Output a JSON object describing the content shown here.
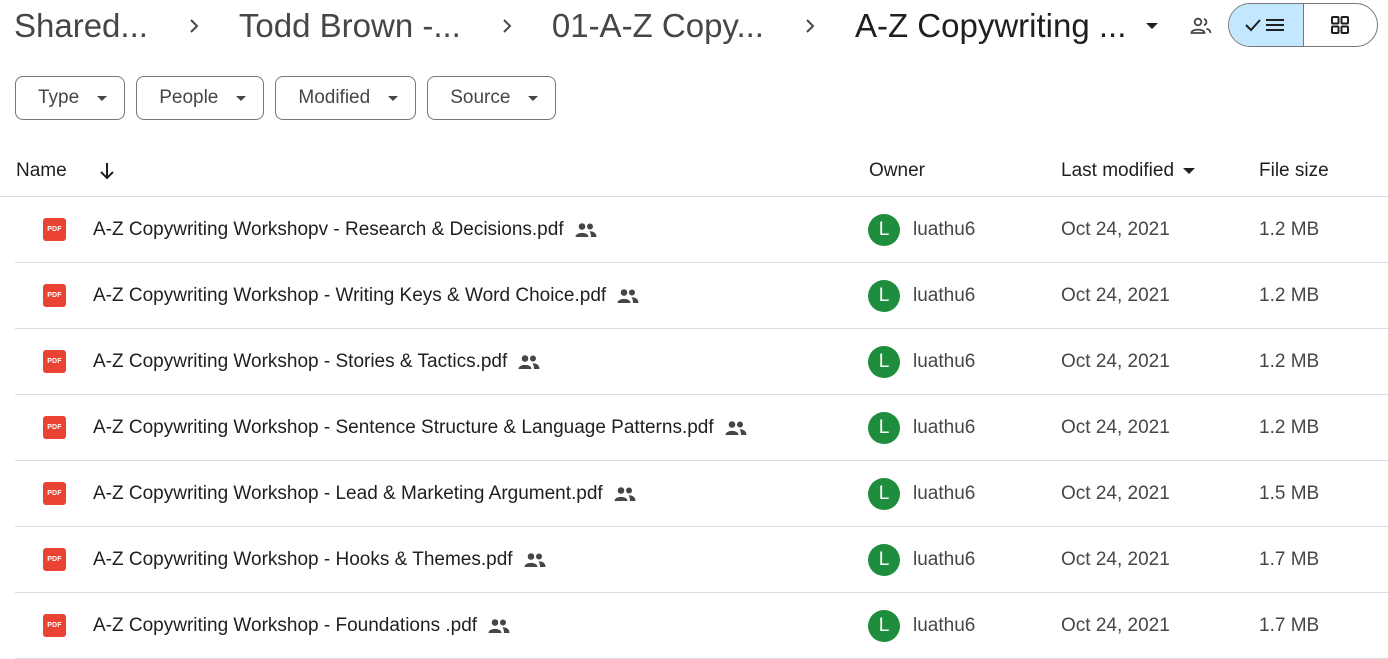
{
  "breadcrumb": {
    "items": [
      "Shared...",
      "Todd Brown -...",
      "01-A-Z Copy...",
      "A-Z Copywriting ..."
    ]
  },
  "view_toggle": {
    "active": "list"
  },
  "filters": [
    "Type",
    "People",
    "Modified",
    "Source"
  ],
  "table": {
    "columns": {
      "name": "Name",
      "owner": "Owner",
      "last_modified": "Last modified",
      "file_size": "File size"
    },
    "rows": [
      {
        "name": "A-Z Copywriting Workshopv - Research & Decisions.pdf",
        "owner_initial": "L",
        "owner": "luathu6",
        "modified": "Oct 24, 2021",
        "size": "1.2 MB"
      },
      {
        "name": "A-Z Copywriting Workshop - Writing Keys & Word Choice.pdf",
        "owner_initial": "L",
        "owner": "luathu6",
        "modified": "Oct 24, 2021",
        "size": "1.2 MB"
      },
      {
        "name": "A-Z Copywriting Workshop - Stories & Tactics.pdf",
        "owner_initial": "L",
        "owner": "luathu6",
        "modified": "Oct 24, 2021",
        "size": "1.2 MB"
      },
      {
        "name": "A-Z Copywriting Workshop - Sentence Structure & Language Patterns.pdf",
        "owner_initial": "L",
        "owner": "luathu6",
        "modified": "Oct 24, 2021",
        "size": "1.2 MB"
      },
      {
        "name": "A-Z Copywriting Workshop - Lead & Marketing Argument.pdf",
        "owner_initial": "L",
        "owner": "luathu6",
        "modified": "Oct 24, 2021",
        "size": "1.5 MB"
      },
      {
        "name": "A-Z Copywriting Workshop - Hooks & Themes.pdf",
        "owner_initial": "L",
        "owner": "luathu6",
        "modified": "Oct 24, 2021",
        "size": "1.7 MB"
      },
      {
        "name": "A-Z Copywriting Workshop - Foundations .pdf",
        "owner_initial": "L",
        "owner": "luathu6",
        "modified": "Oct 24, 2021",
        "size": "1.7 MB"
      }
    ]
  },
  "icons": {
    "pdf_label": "PDF"
  },
  "colors": {
    "pdf_red": "#ea4335",
    "avatar_green": "#1e8e3e",
    "toggle_active": "#c2e7ff"
  }
}
